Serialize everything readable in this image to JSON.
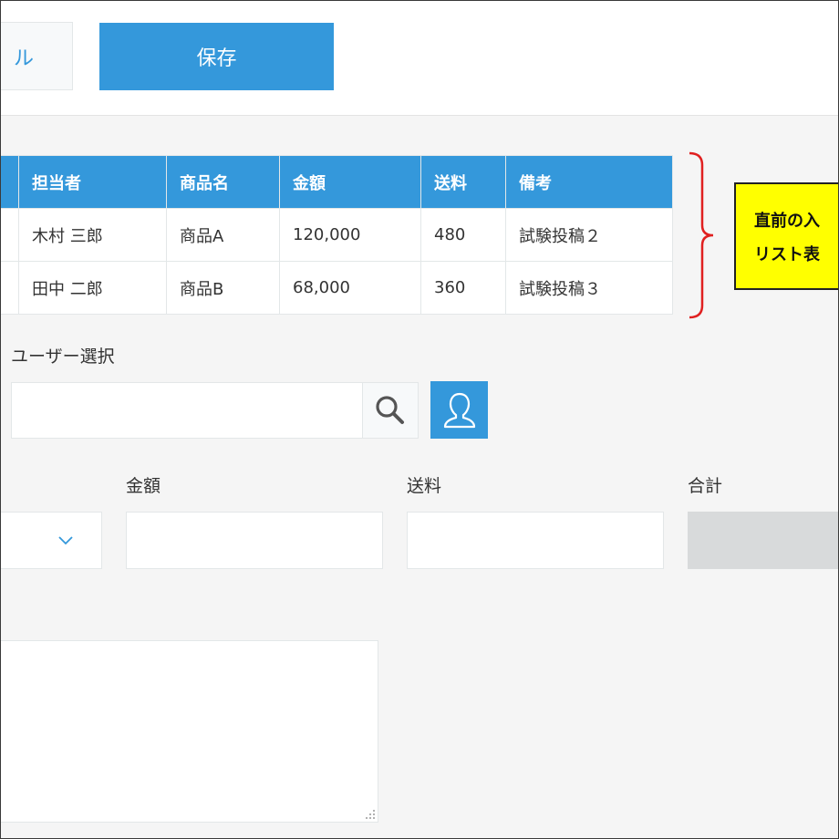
{
  "toolbar": {
    "cancel_label": "ル",
    "save_label": "保存"
  },
  "table": {
    "headers": [
      "担当者",
      "商品名",
      "金額",
      "送料",
      "備考"
    ],
    "rows": [
      [
        "木村 三郎",
        "商品A",
        "120,000",
        "480",
        "試験投稿２"
      ],
      [
        "田中 二郎",
        "商品B",
        "68,000",
        "360",
        "試験投稿３"
      ]
    ]
  },
  "callout": {
    "line1": "直前の入",
    "line2": "リスト表"
  },
  "user_select": {
    "label": "ユーザー選択",
    "value": ""
  },
  "fields": {
    "amount_label": "金額",
    "shipping_label": "送料",
    "total_label": "合計"
  },
  "icons": {
    "search": "search-icon",
    "user": "user-icon",
    "select": "chevron-down-icon"
  },
  "colors": {
    "accent": "#3498db",
    "callout_bg": "#ffff00",
    "bracket": "#e02020"
  }
}
